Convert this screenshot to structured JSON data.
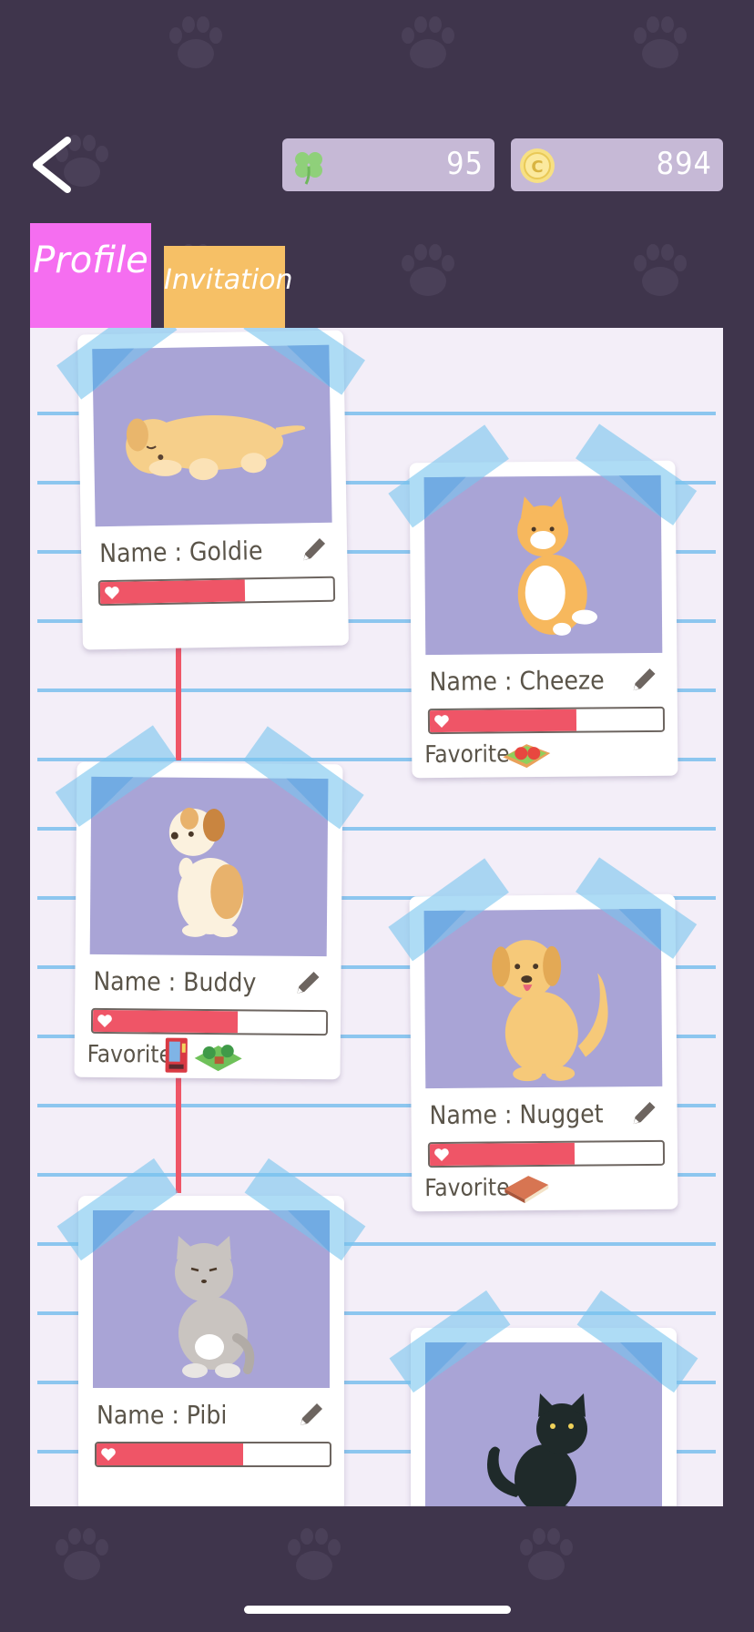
{
  "header": {
    "clover_count": "95",
    "coin_count": "894",
    "clover_icon": "clover-icon",
    "coin_icon": "coin-icon",
    "coin_symbol": "C"
  },
  "tabs": [
    {
      "label": "Profile",
      "active": true
    },
    {
      "label": "Invitation",
      "active": false
    }
  ],
  "colors": {
    "background": "#3f354c",
    "profile_tab": "#f56ef0",
    "invitation_tab": "#f6c066",
    "currency_chip": "#c6b9d6",
    "panel": "#f3eef8",
    "ruled_line": "#8cc6ef",
    "affection_bar": "#ef5567",
    "photo_bg": "#a9a4d6"
  },
  "pets": [
    {
      "id": "goldie",
      "name_label": "Name : Goldie",
      "affection": 0.62,
      "favorite_label": "",
      "favorites": []
    },
    {
      "id": "cheeze",
      "name_label": "Name : Cheeze",
      "affection": 0.63,
      "favorite_label": "Favorite :",
      "favorites": [
        "tomato-toast-icon"
      ]
    },
    {
      "id": "buddy",
      "name_label": "Name : Buddy",
      "affection": 0.62,
      "favorite_label": "Favorite :",
      "favorites": [
        "vending-machine-icon",
        "park-icon"
      ]
    },
    {
      "id": "nugget",
      "name_label": "Name : Nugget",
      "affection": 0.62,
      "favorite_label": "Favorite :",
      "favorites": [
        "book-icon"
      ]
    },
    {
      "id": "pibi",
      "name_label": "Name : Pibi",
      "affection": 0.63,
      "favorite_label": "",
      "favorites": []
    },
    {
      "id": "black-cat",
      "name_label": "",
      "affection": null,
      "favorite_label": "",
      "favorites": []
    }
  ]
}
